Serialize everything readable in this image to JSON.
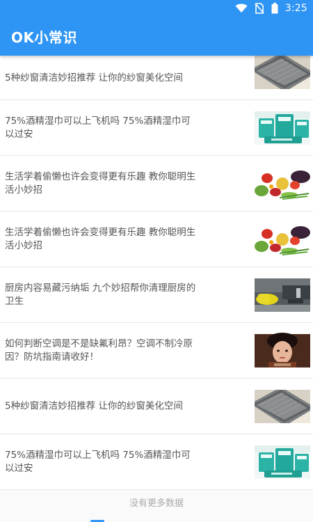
{
  "status_bar": {
    "time": "3:25",
    "icons": [
      "wifi-icon",
      "no-sim-icon",
      "battery-icon"
    ]
  },
  "app_bar": {
    "title": "OK小常识"
  },
  "colors": {
    "primary": "#2f95f5",
    "text": "#555555",
    "divider": "#e6e6e6",
    "footer_text": "#aaaaaa"
  },
  "list": {
    "items": [
      {
        "title": "5种纱窗清洁妙招推荐 让你的纱窗美化空间",
        "thumb": "window-screen-image"
      },
      {
        "title": "75%酒精湿巾可以上飞机吗 75%酒精湿巾可以过安",
        "thumb": "alcohol-wipes-image"
      },
      {
        "title": "生活学着偷懒也许会变得更有乐趣 教你聪明生活小妙招",
        "thumb": "vegetables-image"
      },
      {
        "title": "生活学着偷懒也许会变得更有乐趣 教你聪明生活小妙招",
        "thumb": "vegetables-image"
      },
      {
        "title": "厨房内容易藏污纳垢 九个妙招帮你清理厨房的卫生",
        "thumb": "kitchen-cleaning-image"
      },
      {
        "title": "如何判断空调是不是缺氟利昂？空调不制冷原因？防坑指南请收好！",
        "thumb": "woman-portrait-image"
      },
      {
        "title": "5种纱窗清洁妙招推荐 让你的纱窗美化空间",
        "thumb": "window-screen-image"
      },
      {
        "title": "75%酒精湿巾可以上飞机吗 75%酒精湿巾可以过安",
        "thumb": "alcohol-wipes-image"
      }
    ],
    "footer": "没有更多数据"
  }
}
